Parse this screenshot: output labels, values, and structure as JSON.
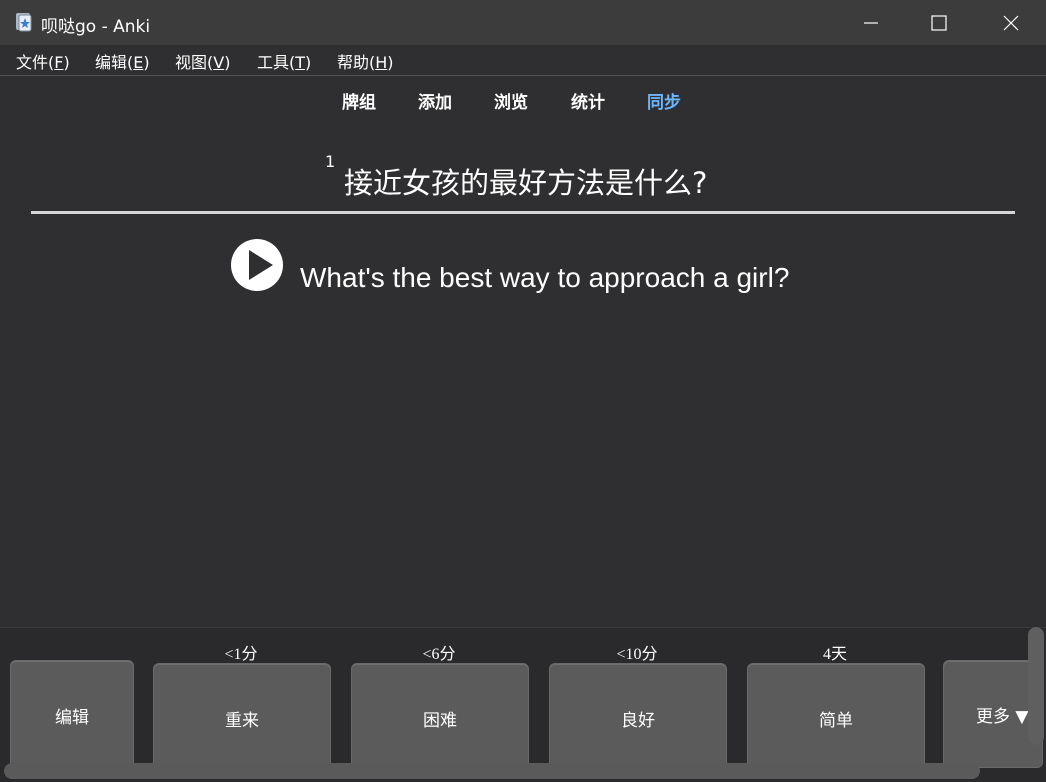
{
  "window": {
    "title": "呗哒go - Anki",
    "app_icon": "anki-app-icon",
    "minimize_icon": "minimize-icon",
    "maximize_icon": "maximize-icon",
    "close_icon": "close-icon"
  },
  "menu": {
    "items": [
      {
        "label": "文件(",
        "key": "F",
        "tail": ")"
      },
      {
        "label": "编辑(",
        "key": "E",
        "tail": ")"
      },
      {
        "label": "视图(",
        "key": "V",
        "tail": ")"
      },
      {
        "label": "工具(",
        "key": "T",
        "tail": ")"
      },
      {
        "label": "帮助(",
        "key": "H",
        "tail": ")"
      }
    ]
  },
  "toolbar": {
    "links": [
      {
        "label": "牌组"
      },
      {
        "label": "添加"
      },
      {
        "label": "浏览"
      },
      {
        "label": "统计"
      },
      {
        "label": "同步"
      }
    ],
    "active_color": "#6cb6ff"
  },
  "card": {
    "question_superscript": "1",
    "question": "接近女孩的最好方法是什么?",
    "answer": "What's the best way to approach a girl?",
    "audio_icon": "play-audio-icon"
  },
  "bottom": {
    "edit_label": "编辑",
    "answers": [
      {
        "due": "<1分",
        "label": "重来"
      },
      {
        "due": "<6分",
        "label": "困难"
      },
      {
        "due": "<10分",
        "label": "良好"
      },
      {
        "due": "4天",
        "label": "简单"
      }
    ],
    "more_label": "更多 ▼"
  }
}
